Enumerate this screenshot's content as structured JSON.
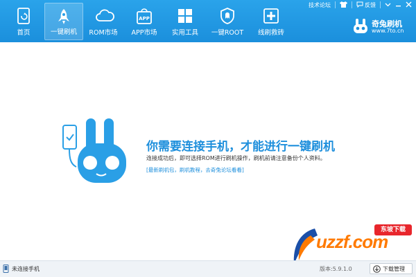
{
  "header": {
    "nav": [
      {
        "label": "首页",
        "icon": "home-icon"
      },
      {
        "label": "一键刷机",
        "icon": "rocket-icon"
      },
      {
        "label": "ROM市场",
        "icon": "cloud-icon"
      },
      {
        "label": "APP市场",
        "icon": "shopping-bag-icon"
      },
      {
        "label": "实用工具",
        "icon": "grid-icon"
      },
      {
        "label": "一键ROOT",
        "icon": "shield-icon"
      },
      {
        "label": "线刷救砖",
        "icon": "plus-box-icon"
      }
    ],
    "active_tab": "一键刷机",
    "top_links": {
      "forum": "技术论坛",
      "feedback": "反馈"
    },
    "brand": {
      "name": "奇兔刷机",
      "url": "www.7to.cn"
    }
  },
  "main": {
    "headline": "你需要连接手机，才能进行一键刷机",
    "description": "连接成功后，即可选择ROM进行刷机操作，刷机前请注意备份个人资料。",
    "link": "[最新刷机包，刷机教程，去奇兔论坛看看]"
  },
  "status": {
    "connection": "未连接手机",
    "version": "版本:5.9.1.0",
    "download_button": "下载管理"
  },
  "watermark": {
    "text": "uzzf.com",
    "badge": "东坡下载"
  },
  "colors": {
    "header_blue": "#1b8fdc",
    "accent": "#1e8fdc",
    "watermark_orange": "#ff7a00"
  }
}
